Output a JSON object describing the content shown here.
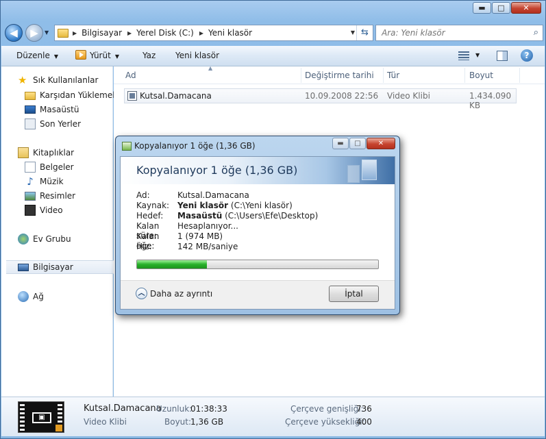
{
  "window": {
    "minimize_glyph": "▬",
    "maximize_glyph": "□",
    "close_glyph": "✕"
  },
  "address": {
    "crumbs": [
      "Bilgisayar",
      "Yerel Disk (C:)",
      "Yeni klasör"
    ],
    "search_placeholder": "Ara: Yeni klasör"
  },
  "toolbar": {
    "organize": "Düzenle",
    "play": "Yürüt",
    "burn": "Yaz",
    "new_folder": "Yeni klasör"
  },
  "sidebar": {
    "favorites": "Sık Kullanılanlar",
    "downloads": "Karşıdan Yüklemeler",
    "desktop": "Masaüstü",
    "recent": "Son Yerler",
    "libraries": "Kitaplıklar",
    "documents": "Belgeler",
    "music": "Müzik",
    "pictures": "Resimler",
    "video": "Video",
    "homegroup": "Ev Grubu",
    "computer": "Bilgisayar",
    "network": "Ağ"
  },
  "list": {
    "columns": [
      "Ad",
      "Değiştirme tarihi",
      "Tür",
      "Boyut"
    ],
    "rows": [
      {
        "name": "Kutsal.Damacana",
        "date": "10.09.2008 22:56",
        "type": "Video Klibi",
        "size": "1.434.090 KB"
      }
    ]
  },
  "details": {
    "name": "Kutsal.Damacana",
    "type": "Video Klibi",
    "length_label": "Uzunluk:",
    "length": "01:38:33",
    "size_label": "Boyut:",
    "size": "1,36 GB",
    "width_label": "Çerçeve genişliği:",
    "width": "736",
    "height_label": "Çerçeve yüksekliği:",
    "height": "400"
  },
  "dialog": {
    "title": "Kopyalanıyor 1 öğe (1,36 GB)",
    "heading": "Kopyalanıyor 1 öğe (1,36 GB)",
    "name_label": "Ad:",
    "name_value": "Kutsal.Damacana",
    "source_label": "Kaynak:",
    "source_bold": "Yeni klasör",
    "source_path": "(C:\\Yeni klasör)",
    "dest_label": "Hedef:",
    "dest_bold": "Masaüstü",
    "dest_path": "(C:\\Users\\Efe\\Desktop)",
    "time_label": "Kalan süre:",
    "time_value": "Hesaplanıyor...",
    "items_label": "Kalan öğe:",
    "items_value": "1 (974 MB)",
    "speed_label": "Hız:",
    "speed_value": "142 MB/saniye",
    "progress": 0.29,
    "less_details": "Daha az ayrıntı",
    "cancel": "İptal"
  }
}
